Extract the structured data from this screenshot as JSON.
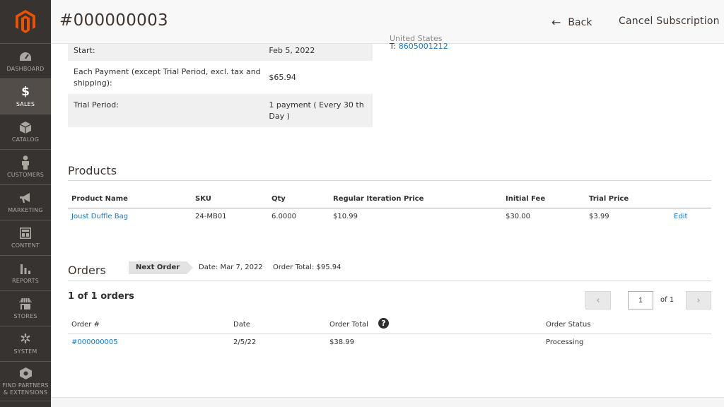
{
  "header": {
    "title": "#000000003",
    "back_label": "Back",
    "cancel_label": "Cancel Subscription"
  },
  "sidebar": {
    "items": [
      {
        "label": "Dashboard",
        "icon": "dashboard-icon"
      },
      {
        "label": "Sales",
        "icon": "dollar-icon",
        "active": true
      },
      {
        "label": "Catalog",
        "icon": "cube-icon"
      },
      {
        "label": "Customers",
        "icon": "person-icon"
      },
      {
        "label": "Marketing",
        "icon": "megaphone-icon"
      },
      {
        "label": "Content",
        "icon": "content-icon"
      },
      {
        "label": "Reports",
        "icon": "bar-chart-icon"
      },
      {
        "label": "Stores",
        "icon": "store-icon"
      },
      {
        "label": "System",
        "icon": "gear-icon"
      },
      {
        "label": "Find Partners & Extensions",
        "icon": "partners-icon"
      }
    ]
  },
  "info": {
    "rows": [
      {
        "key": "Start:",
        "value": "Feb 5, 2022"
      },
      {
        "key": "Each Payment (except Trial Period, excl. tax and shipping):",
        "value": "$65.94"
      },
      {
        "key": "Trial Period:",
        "value": "1 payment ( Every 30 th Day )"
      }
    ],
    "address_clipped": "United States",
    "phone_prefix": "T:",
    "phone": "8605001212"
  },
  "products": {
    "title": "Products",
    "columns": [
      "Product Name",
      "SKU",
      "Qty",
      "Regular Iteration Price",
      "Initial Fee",
      "Trial Price"
    ],
    "rows": [
      {
        "name": "Joust Duffle Bag",
        "sku": "24-MB01",
        "qty": "6.0000",
        "regular_price": "$10.99",
        "initial_fee": "$30.00",
        "trial_price": "$3.99",
        "action": "Edit"
      }
    ]
  },
  "orders": {
    "title": "Orders",
    "next_order_label": "Next Order",
    "next_order_date": "Date: Mar 7, 2022",
    "next_order_total": "Order Total: $95.94",
    "count_label": "1 of 1 orders",
    "page_value": "1",
    "page_of": "of 1",
    "columns": [
      "Order #",
      "Date",
      "Order Total",
      "Order Status"
    ],
    "rows": [
      {
        "order_no": "#000000005",
        "date": "2/5/22",
        "total": "$38.99",
        "status": "Processing"
      }
    ]
  },
  "colors": {
    "sidebar_bg": "#373330",
    "active_bg": "#524d49",
    "logo_orange": "#eb5202",
    "link": "#1979c3"
  }
}
